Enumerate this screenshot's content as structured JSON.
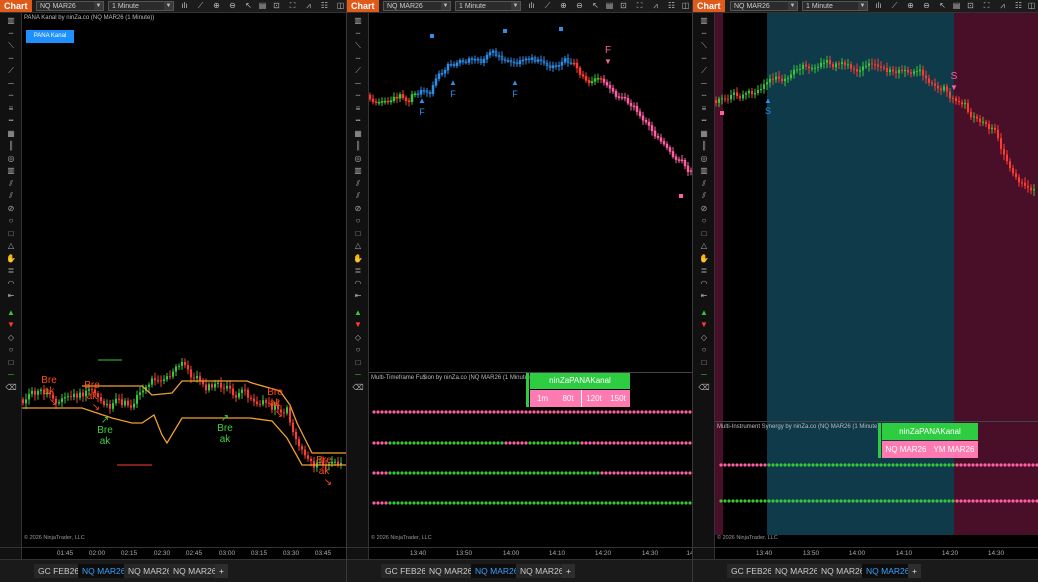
{
  "toolbar": {
    "chart_label": "Chart",
    "timeframe": "1 Minute"
  },
  "panes": [
    {
      "instrument": "NQ MAR26",
      "title": "PANA Kanal by ninZa.co (NQ MAR26 (1 Minute))",
      "legend_button": "PANA Kanal",
      "copyright": "© 2026 NinjaTrader, LLC",
      "x_ticks": [
        "01:45",
        "02:00",
        "02:15",
        "02:30",
        "02:45",
        "03:00",
        "03:15",
        "03:30",
        "03:45"
      ],
      "break_label": "Bre\nak",
      "tabs": [
        "GC FEB26",
        "NQ MAR26",
        "NQ MAR26",
        "NQ MAR26"
      ],
      "active_tab": 1
    },
    {
      "instrument": "NQ MAR26",
      "sub_title": "Multi-Timeframe Fu$ion by ninZa.co (NQ MAR26 (1 Minute))",
      "kanal_label": "ninZaPANAKanal",
      "timeframes": [
        "1m",
        "80t",
        "120t",
        "150t"
      ],
      "signal_F": "F",
      "copyright": "© 2026 NinjaTrader, LLC",
      "x_ticks": [
        "13:40",
        "13:50",
        "14:00",
        "14:10",
        "14:20",
        "14:30",
        "14"
      ],
      "tabs": [
        "GC FEB26",
        "NQ MAR26",
        "NQ MAR26",
        "NQ MAR26"
      ],
      "active_tab": 2
    },
    {
      "instrument": "NQ MAR26",
      "sub_title": "Multi-Instrument Synergy by ninZa.co (NQ MAR26 (1 Minute))",
      "kanal_label": "ninZaPANAKanal",
      "instruments": [
        "NQ MAR26",
        "YM MAR26"
      ],
      "signal_S": "S",
      "copyright": "© 2026 NinjaTrader, LLC",
      "x_ticks": [
        "13:40",
        "13:50",
        "14:00",
        "14:10",
        "14:20",
        "14:30"
      ],
      "tabs": [
        "GC FEB26",
        "NQ MAR26",
        "NQ MAR26",
        "NQ MAR26"
      ],
      "active_tab": 3
    }
  ],
  "colors": {
    "up": "#37c837",
    "down": "#ff3b30",
    "pink": "#ff5fa2",
    "blue": "#2e8ee8",
    "channel": "#f0a030",
    "teal": "#0f3a4a",
    "maroon": "#4a0f28"
  }
}
